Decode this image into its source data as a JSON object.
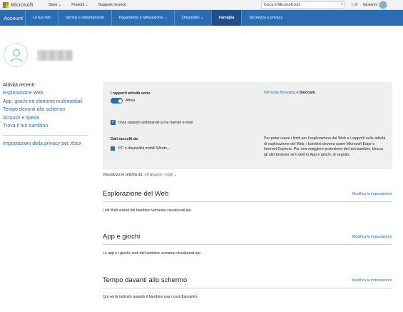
{
  "header": {
    "brand": "Microsoft",
    "nav": [
      "Store",
      "Prodotti",
      "Supporto tecnico"
    ],
    "search_placeholder": "Cerca in Microsoft.com",
    "cart_count": "0",
    "user_name": "Giovanni"
  },
  "account_nav": {
    "title": "Account",
    "items": [
      "Le tue info",
      "Servizi e abbonamenti",
      "Pagamento e fatturazione",
      "Dispositivi",
      "Famiglia",
      "Sicurezza e privacy"
    ],
    "active": "Famiglia"
  },
  "sidebar": {
    "heading": "Attività recenti:",
    "links": [
      "Esplorazione Web",
      "App, giochi ed elementi multimediali",
      "Tempo davanti allo schermo",
      "Acquisti e spese",
      "Trova il tuo bambino"
    ],
    "privacy_link": "Impostazioni della privacy per Xbox"
  },
  "panel": {
    "reports_label": "I rapporti attività sono",
    "toggle_state": "Attiva",
    "weekly_checkbox": "Invia rapporti settimanali a me tramite e-mail",
    "data_label": "Dati raccolti da",
    "device_text": "PC e dispositivi mobili Windo...",
    "inprivate_link": "InPrivate Browsing",
    "inprivate_rest": " è ",
    "inprivate_status": "bloccato",
    "paragraph": "Per poter usare i limiti per l'esplorazione del Web e i rapporti sulle attività di esplorazione del Web, i bambini devono usare Microsoft Edge e Internet Explorer. Per una maggiore protezione dei tuoi bambini, blocca gli altri browser se li vedi in App e giochi, di seguito."
  },
  "period": {
    "prefix": "Visualizza le attività da:",
    "value": "16 giugno - oggi"
  },
  "sections": [
    {
      "title": "Esplorazione del Web",
      "edit": "Modifica le impostazioni",
      "desc": "I siti Web visitati dal bambino verranno visualizzati qui."
    },
    {
      "title": "App e giochi",
      "edit": "Modifica le impostazioni",
      "desc": "Le app e i giochi usati dal bambino verranno visualizzati qui."
    },
    {
      "title": "Tempo davanti allo schermo",
      "edit": "Modifica le impostazioni",
      "desc": "Qui verrà indicato quando il bambino usa i suoi dispositivi."
    }
  ],
  "colors": {
    "accent": "#2a6db5",
    "nav_active": "#1f4f8a",
    "panel_bg": "#efefef"
  }
}
